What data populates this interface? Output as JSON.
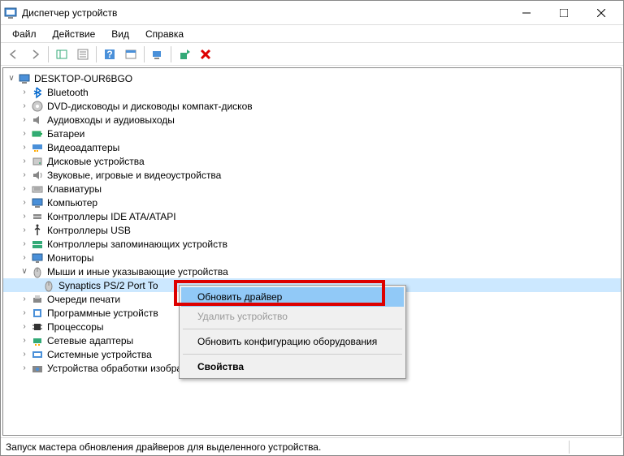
{
  "window": {
    "title": "Диспетчер устройств"
  },
  "menubar": {
    "file": "Файл",
    "action": "Действие",
    "view": "Вид",
    "help": "Справка"
  },
  "tree": {
    "root": "DESKTOP-OUR6BGO",
    "cat0": "Bluetooth",
    "cat1": "DVD-дисководы и дисководы компакт-дисков",
    "cat2": "Аудиовходы и аудиовыходы",
    "cat3": "Батареи",
    "cat4": "Видеоадаптеры",
    "cat5": "Дисковые устройства",
    "cat6": "Звуковые, игровые и видеоустройства",
    "cat7": "Клавиатуры",
    "cat8": "Компьютер",
    "cat9": "Контроллеры IDE ATA/ATAPI",
    "cat10": "Контроллеры USB",
    "cat11": "Контроллеры запоминающих устройств",
    "cat12": "Мониторы",
    "cat13": "Мыши и иные указывающие устройства",
    "dev13_0": "Synaptics PS/2 Port To",
    "cat14": "Очереди печати",
    "cat15": "Программные устройств",
    "cat16": "Процессоры",
    "cat17": "Сетевые адаптеры",
    "cat18": "Системные устройства",
    "cat19": "Устройства обработки изображений"
  },
  "context": {
    "update": "Обновить драйвер",
    "delete": "Удалить устройство",
    "refresh": "Обновить конфигурацию оборудования",
    "properties": "Свойства"
  },
  "statusbar": {
    "text": "Запуск мастера обновления драйверов для выделенного устройства."
  }
}
